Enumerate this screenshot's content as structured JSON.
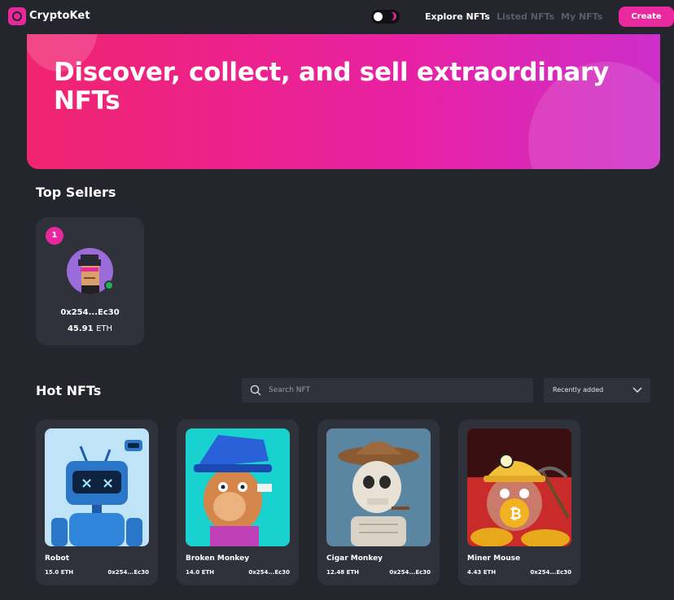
{
  "app": {
    "logo_text": "CryptoKet"
  },
  "nav": {
    "links": [
      "Explore NFTs",
      "Listed NFTs",
      "My NFTs"
    ],
    "create_label": "Create"
  },
  "hero": {
    "title": "Discover, collect, and sell extraordinary NFTs"
  },
  "top_sellers": {
    "title": "Top Sellers",
    "sellers": [
      {
        "rank": "1",
        "address": "0x254...Ec30",
        "amount": "45.91",
        "unit": "ETH"
      }
    ]
  },
  "hot_nfts": {
    "title": "Hot NFTs",
    "search_placeholder": "Search NFT",
    "sort_value": "Recently added",
    "items": [
      {
        "name": "Robot",
        "price": "15.0 ETH",
        "owner": "0x254...Ec30"
      },
      {
        "name": "Broken Monkey",
        "price": "14.0 ETH",
        "owner": "0x254...Ec30"
      },
      {
        "name": "Cigar Monkey",
        "price": "12.48 ETH",
        "owner": "0x254...Ec30"
      },
      {
        "name": "Miner Mouse",
        "price": "4.43 ETH",
        "owner": "0x254...Ec30"
      }
    ]
  },
  "colors": {
    "background": "#24252d",
    "card": "#2f313b",
    "accent": "#e8289c",
    "muted_text": "#5b5c66"
  }
}
